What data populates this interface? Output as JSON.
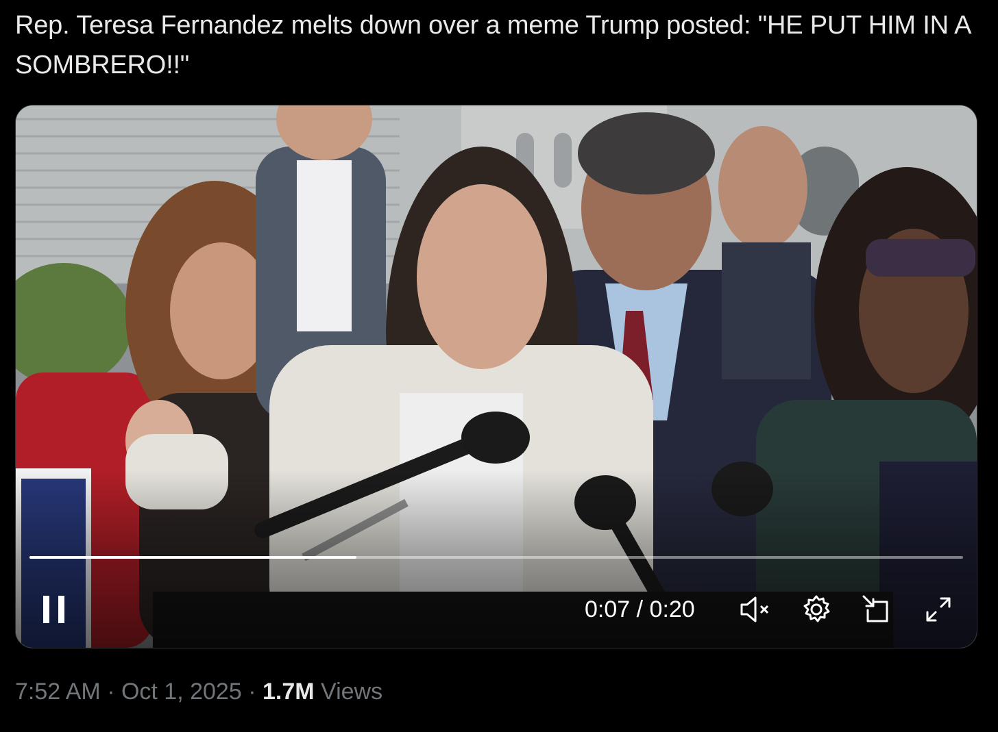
{
  "post": {
    "text": "Rep. Teresa Fernandez melts down over a meme Trump posted: \"HE PUT HIM IN A SOMBRERO!!\""
  },
  "video": {
    "progress": 0.35,
    "time_current": "0:07",
    "time_separator": "/",
    "time_total": "0:20",
    "controls": {
      "pause_icon": "pause-icon",
      "mute_icon": "muted-speaker-icon",
      "settings_icon": "gear-icon",
      "pip_icon": "picture-in-picture-icon",
      "fullscreen_icon": "expand-icon"
    }
  },
  "meta": {
    "time": "7:52 AM",
    "sep1": " · ",
    "date": "Oct 1, 2025",
    "sep2": " · ",
    "views_count": "1.7M",
    "views_label": " Views"
  },
  "colors": {
    "background": "#000000",
    "text_primary": "#e7e9ea",
    "text_secondary": "#71767b",
    "border": "#2f3336"
  }
}
